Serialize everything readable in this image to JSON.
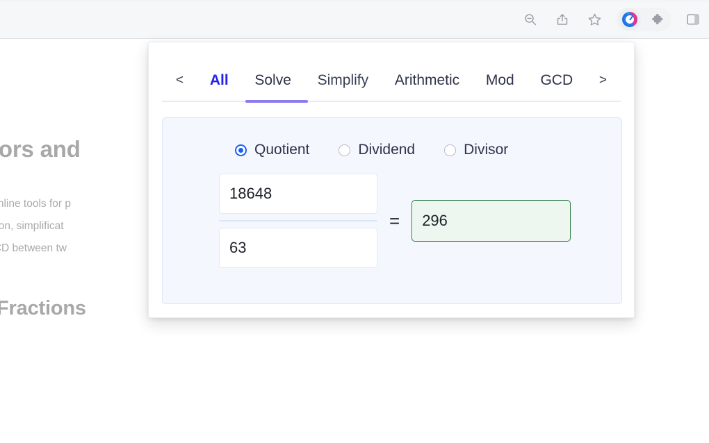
{
  "browser": {
    "toolbar_icons": [
      {
        "name": "zoom-out-icon",
        "label": "Zoom out"
      },
      {
        "name": "share-icon",
        "label": "Share"
      },
      {
        "name": "bookmark-star-icon",
        "label": "Bookmark"
      },
      {
        "name": "fraction-calculator-extension-icon",
        "label": "Fraction Calculator"
      },
      {
        "name": "extensions-puzzle-icon",
        "label": "Extensions"
      },
      {
        "name": "sidebar-toggle-icon",
        "label": "Sidebar"
      }
    ]
  },
  "page": {
    "heading": "ulators and",
    "paragraph_lines": [
      "of free online tools for p",
      "conversion, simplificat",
      "g the GCD between tw"
    ],
    "subheading": "with Fractions"
  },
  "popup": {
    "nav": {
      "prev": "<",
      "next": ">"
    },
    "tabs": [
      {
        "label": "All",
        "state": "highlighted"
      },
      {
        "label": "Solve",
        "state": "selected"
      },
      {
        "label": "Simplify",
        "state": "normal"
      },
      {
        "label": "Arithmetic",
        "state": "normal"
      },
      {
        "label": "Mod",
        "state": "normal"
      },
      {
        "label": "GCD",
        "state": "normal"
      }
    ],
    "solver": {
      "radios": [
        {
          "label": "Quotient",
          "checked": true
        },
        {
          "label": "Dividend",
          "checked": false
        },
        {
          "label": "Divisor",
          "checked": false
        }
      ],
      "dividend_value": "18648",
      "divisor_value": "63",
      "equals_symbol": "=",
      "result_value": "296"
    },
    "colors": {
      "accent_blue": "#2222ee",
      "tab_indicator_purple": "#8b7cf0",
      "radio_blue": "#1a5ff0",
      "result_border_green": "#2f7d46",
      "result_fill_green": "#eef7ef",
      "panel_bg": "#f4f7fd"
    }
  }
}
